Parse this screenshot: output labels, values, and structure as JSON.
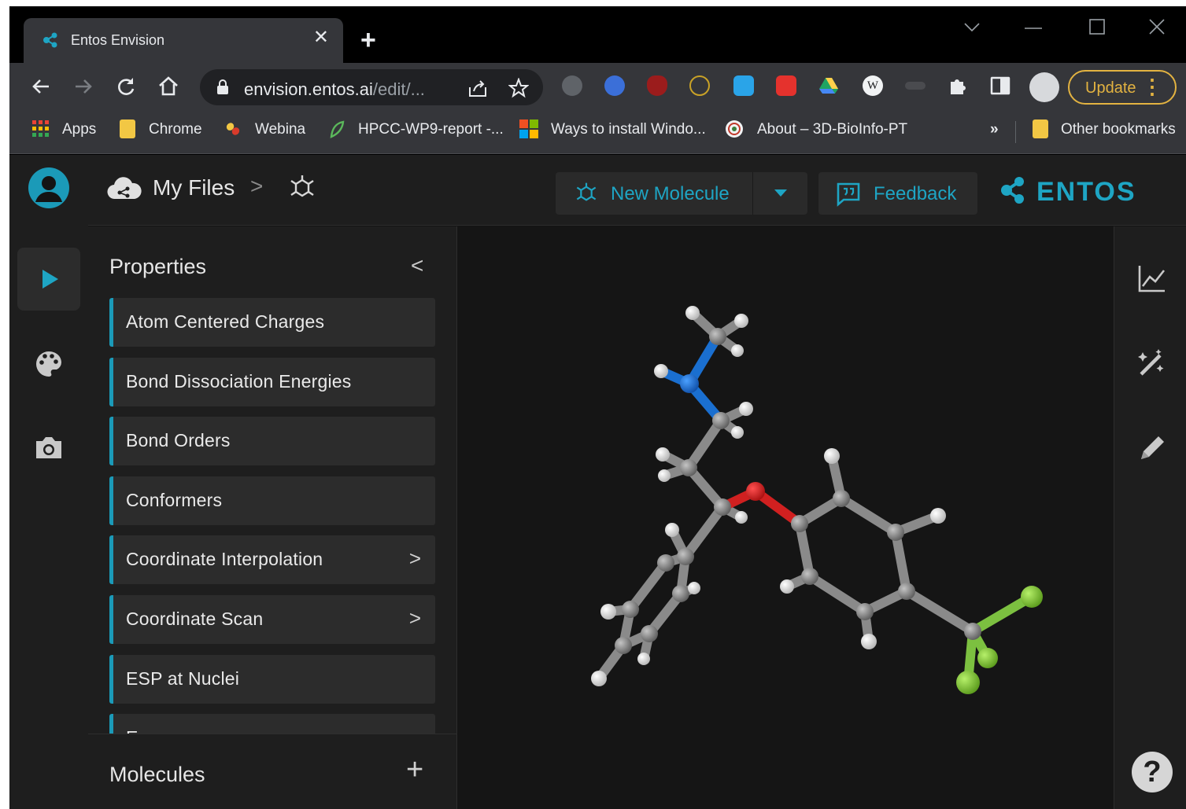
{
  "browser": {
    "tab_title": "Entos Envision",
    "tab_close": "✕",
    "new_tab": "+",
    "url_host": "envision.entos.ai",
    "url_path": "/edit/...",
    "update_label": "Update",
    "update_menu": "⋮"
  },
  "bookmarks": {
    "items": [
      {
        "label": "Apps",
        "icon": "apps-grid-icon"
      },
      {
        "label": "Chrome",
        "icon": "folder-icon"
      },
      {
        "label": "Webina",
        "icon": "pill-icon"
      },
      {
        "label": "HPCC-WP9-report -...",
        "icon": "leaf-icon"
      },
      {
        "label": "Ways to install Windo...",
        "icon": "windows-logo-icon"
      },
      {
        "label": "About – 3D-BioInfo-PT",
        "icon": "site-icon"
      }
    ],
    "overflow": "»",
    "other": "Other bookmarks"
  },
  "app": {
    "breadcrumb_root": "My Files",
    "breadcrumb_sep": ">",
    "new_molecule_label": "New Molecule",
    "feedback_label": "Feedback",
    "brand": "ENTOS",
    "accent_color": "#1ea5c4"
  },
  "properties": {
    "title": "Properties",
    "collapse": "<",
    "items": [
      {
        "label": "Atom Centered Charges",
        "arrow": ""
      },
      {
        "label": "Bond Dissociation Energies",
        "arrow": ""
      },
      {
        "label": "Bond Orders",
        "arrow": ""
      },
      {
        "label": "Conformers",
        "arrow": ""
      },
      {
        "label": "Coordinate Interpolation",
        "arrow": ">"
      },
      {
        "label": "Coordinate Scan",
        "arrow": ">"
      },
      {
        "label": "ESP at Nuclei",
        "arrow": ""
      },
      {
        "label": "E",
        "arrow": ""
      }
    ]
  },
  "molecules": {
    "title": "Molecules",
    "add": "+"
  },
  "help": "?"
}
